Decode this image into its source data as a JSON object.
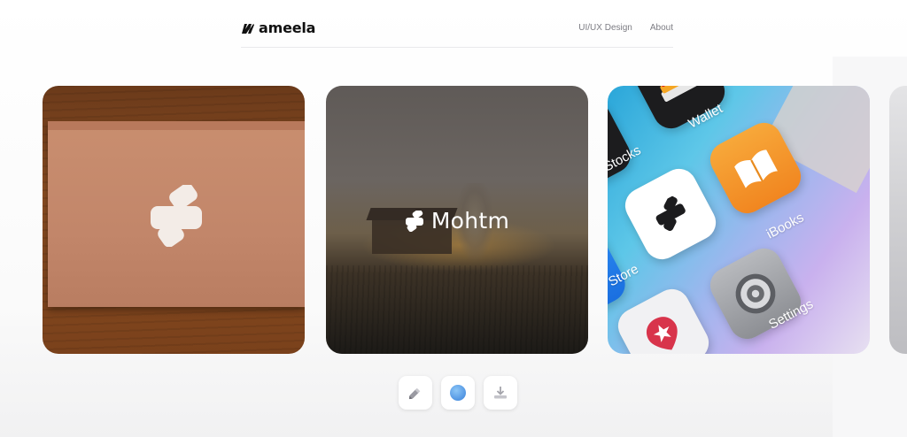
{
  "header": {
    "brand": "ameela",
    "nav": [
      "UI/UX Design",
      "About"
    ]
  },
  "cards": [
    {
      "name": "box-mockup",
      "overlay_text": ""
    },
    {
      "name": "landscape",
      "overlay_text": "Mohtm"
    },
    {
      "name": "phone-homescreen",
      "app_labels": [
        "Wallet",
        "iBooks",
        "Stocks",
        "Store",
        "Settings"
      ]
    }
  ],
  "toolbar": {
    "icons": [
      "pencil-icon",
      "color-circle-icon",
      "download-icon"
    ]
  },
  "colors": {
    "accent_circle": "#5aa0e8",
    "page_bg": "#fafafa"
  }
}
